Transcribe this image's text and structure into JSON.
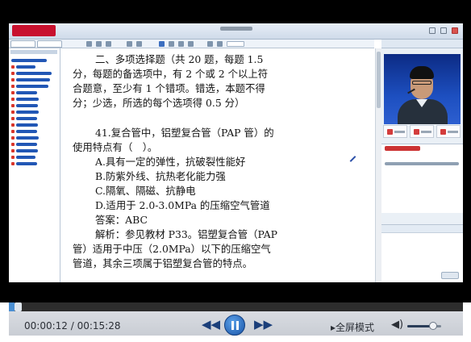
{
  "document": {
    "lines": [
      "二、多项选择题（共 20 题，每题 1.5",
      "分，每题的备选项中，有 2 个或 2 个以上符",
      "合题意，至少有 1 个错项。错选，本题不得",
      "分；少选，所选的每个选项得 0.5 分）",
      "41.复合管中，铝塑复合管（PAP 管）的",
      "使用特点有（　）。",
      "A.具有一定的弹性，抗破裂性能好",
      "B.防紫外线、抗热老化能力强",
      "C.隔氧、隔磁、抗静电",
      "D.适用于 2.0-3.0MPa 的压缩空气管道",
      "答案：ABC",
      "解析：参见教材 P33。铝塑复合管（PAP",
      "管）适用于中压（2.0MPa）以下的压缩空气",
      "管道，其余三项属于铝塑复合管的特点。"
    ]
  },
  "player": {
    "current_time": "00:00:12",
    "separator": " / ",
    "total_time": "00:15:28",
    "fullscreen_label": "▸全屏模式",
    "prev_glyph": "◀◀",
    "next_glyph": "▶▶",
    "volume_glyph": "◀)",
    "progress": 0.013,
    "volume": 0.75
  },
  "colors": {
    "accent": "#1a55a8",
    "brand": "#c8102e",
    "letterbox": "#000000"
  },
  "icons": {
    "prev": "rewind-icon",
    "play": "pause-icon",
    "next": "fast-forward-icon",
    "volume": "speaker-icon",
    "fullscreen": "fullscreen-icon"
  }
}
